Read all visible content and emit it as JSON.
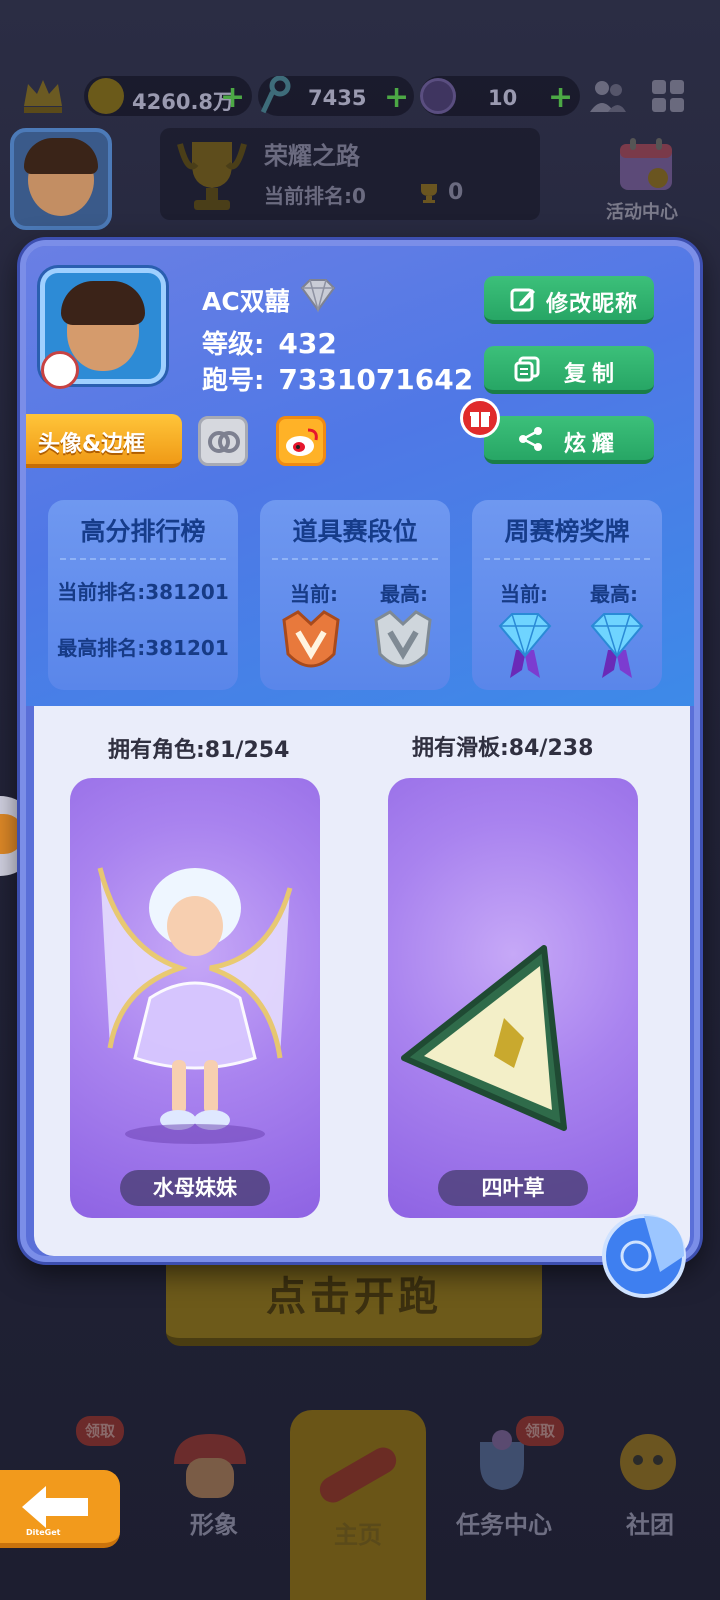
{
  "topbar": {
    "coins": "4260.8万",
    "keys": "7435",
    "gems": "10"
  },
  "honor": {
    "title": "荣耀之路",
    "rank_label": "当前排名:0",
    "trophy_count": "0"
  },
  "event_center": {
    "label": "活动中心"
  },
  "start_button": {
    "label": "点击开跑"
  },
  "profile": {
    "nickname": "AC双囍",
    "level_label": "等级:",
    "level": "432",
    "run_id_label": "跑号:",
    "run_id": "7331071642"
  },
  "actions": {
    "edit_nickname": "修改昵称",
    "copy": "复制",
    "show_off": "炫耀",
    "avatar_frame": "头像&边框"
  },
  "panels": {
    "high_score": {
      "title": "高分排行榜",
      "current_rank": "当前排名:381201",
      "best_rank": "最高排名:381201"
    },
    "item_league": {
      "title": "道具赛段位",
      "current_label": "当前:",
      "best_label": "最高:"
    },
    "weekly_medal": {
      "title": "周赛榜奖牌",
      "current_label": "当前:",
      "best_label": "最高:"
    }
  },
  "collection": {
    "characters_owned": "拥有角色:81/254",
    "boards_owned": "拥有滑板:84/238",
    "character_name": "水母妹妹",
    "board_name": "四叶草"
  },
  "bottom_nav": {
    "items": [
      {
        "label": "形象",
        "badge": "领取"
      },
      {
        "label": "主页"
      },
      {
        "label": "任务中心",
        "badge": "领取"
      },
      {
        "label": "社团"
      }
    ],
    "back_text": "DiteGet"
  },
  "colors": {
    "card_blue": "#5a6fd8",
    "action_green": "#27a665",
    "frame_orange": "#f09a16",
    "panel_text": "#173b86"
  }
}
